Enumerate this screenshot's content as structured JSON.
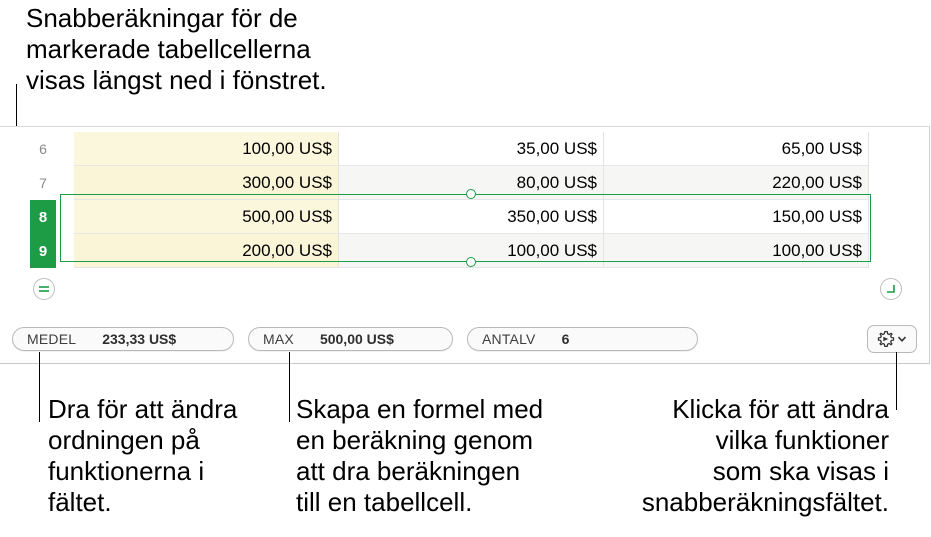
{
  "callouts": {
    "top": [
      "Snabberäkningar för de",
      "markerade tabellcellerna",
      "visas längst ned i fönstret."
    ],
    "reorder": [
      "Dra för att ändra",
      "ordningen på",
      "funktionerna i",
      "fältet."
    ],
    "formula": [
      "Skapa en formel med",
      "en beräkning genom",
      "att dra beräkningen",
      "till en tabellcell."
    ],
    "settings": [
      "Klicka för att ändra",
      "vilka funktioner",
      "som ska visas i",
      "snabberäkningsfältet."
    ]
  },
  "table": {
    "rows": [
      {
        "num": "6",
        "selected": false,
        "cells": [
          "100,00 US$",
          "35,00 US$",
          "65,00 US$"
        ]
      },
      {
        "num": "7",
        "selected": false,
        "cells": [
          "300,00 US$",
          "80,00 US$",
          "220,00 US$"
        ]
      },
      {
        "num": "8",
        "selected": true,
        "cells": [
          "500,00 US$",
          "350,00 US$",
          "150,00 US$"
        ]
      },
      {
        "num": "9",
        "selected": true,
        "cells": [
          "200,00 US$",
          "100,00 US$",
          "100,00 US$"
        ]
      }
    ]
  },
  "quick_calc": {
    "items": [
      {
        "label": "MEDEL",
        "value": "233,33 US$"
      },
      {
        "label": "MAX",
        "value": "500,00 US$"
      },
      {
        "label": "ANTALV",
        "value": "6"
      }
    ]
  },
  "colors": {
    "selection": "#1d9b45",
    "header_column": "#fbf7dc"
  },
  "icons": {
    "add_row": "equals-icon",
    "resize": "corner-resize-icon",
    "settings": "gear-icon",
    "dropdown": "chevron-down-icon"
  }
}
